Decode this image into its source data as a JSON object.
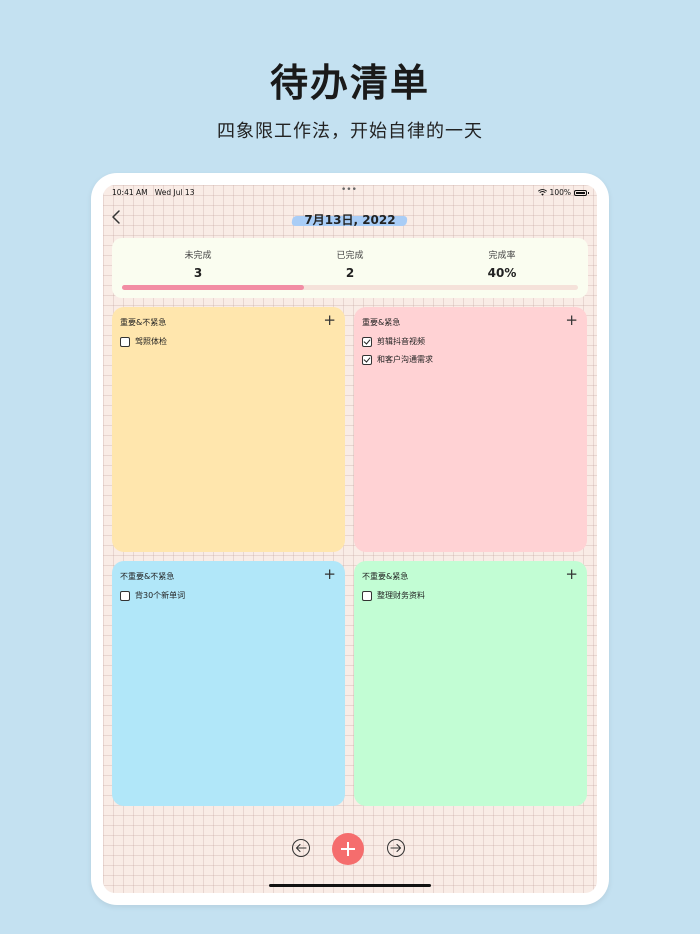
{
  "hero": {
    "title": "待办清单",
    "subtitle": "四象限工作法，开始自律的一天"
  },
  "status_bar": {
    "time": "10:41 AM",
    "date": "Wed Jul 13",
    "battery": "100%",
    "icons": [
      "wifi-icon",
      "battery-icon"
    ]
  },
  "header": {
    "back_icon": "chevron-left-icon",
    "date": "7月13日, 2022",
    "highlight_color": "#a9cdf6"
  },
  "stats": {
    "incomplete_label": "未完成",
    "incomplete_value": "3",
    "complete_label": "已完成",
    "complete_value": "2",
    "rate_label": "完成率",
    "rate_value": "40%",
    "progress_fraction": 0.4,
    "progress_color": "#f28da4"
  },
  "quadrants": [
    {
      "title": "重要&不紧急",
      "color": "#ffe6ad",
      "tasks": [
        {
          "label": "驾照体检",
          "checked": false
        }
      ]
    },
    {
      "title": "重要&紧急",
      "color": "#ffd2d4",
      "tasks": [
        {
          "label": "剪辑抖音视频",
          "checked": true
        },
        {
          "label": "和客户沟通需求",
          "checked": true
        }
      ]
    },
    {
      "title": "不重要&不紧急",
      "color": "#b1e7f9",
      "tasks": [
        {
          "label": "背30个新单词",
          "checked": false
        }
      ]
    },
    {
      "title": "不重要&紧急",
      "color": "#c2fdd4",
      "tasks": [
        {
          "label": "整理财务资料",
          "checked": false
        }
      ]
    }
  ],
  "footer": {
    "prev_icon": "arrow-left-circle-icon",
    "add_icon": "plus-icon",
    "next_icon": "arrow-right-circle-icon",
    "add_color": "#f56d6d"
  },
  "colors": {
    "background": "#c4e1f1",
    "screen_bg": "#f9ece6",
    "stats_bg": "#fafdf0"
  }
}
